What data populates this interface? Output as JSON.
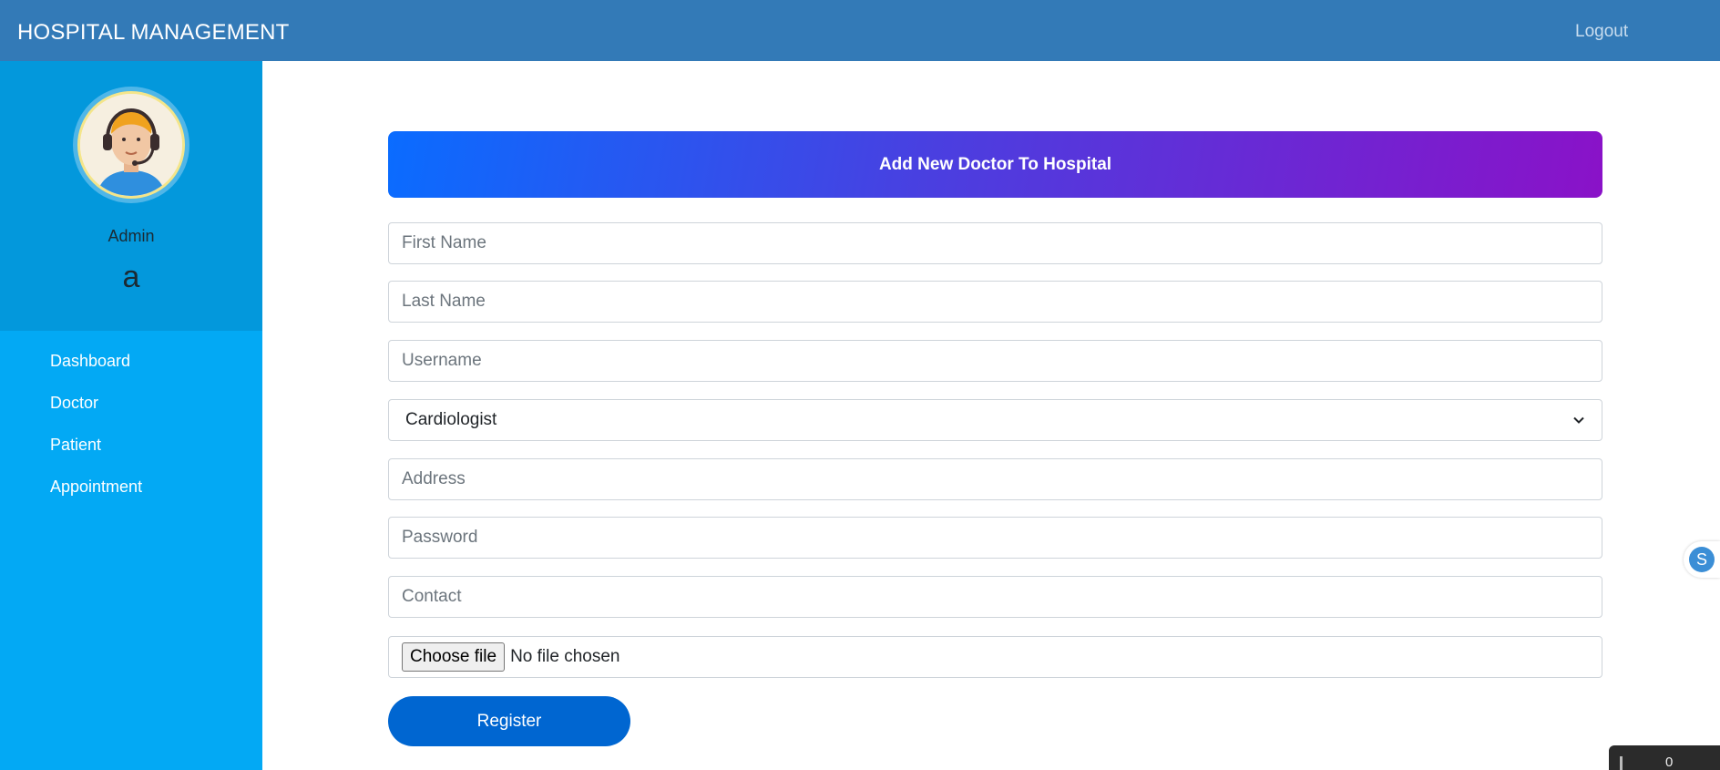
{
  "header": {
    "brand": "HOSPITAL MANAGEMENT",
    "logout_label": "Logout"
  },
  "sidebar": {
    "role": "Admin",
    "username": "a",
    "items": [
      {
        "label": "Dashboard"
      },
      {
        "label": "Doctor"
      },
      {
        "label": "Patient"
      },
      {
        "label": "Appointment"
      }
    ]
  },
  "form": {
    "title": "Add New Doctor To Hospital",
    "first_name_placeholder": "First Name",
    "last_name_placeholder": "Last Name",
    "username_placeholder": "Username",
    "department_value": "Cardiologist",
    "address_placeholder": "Address",
    "password_placeholder": "Password",
    "contact_placeholder": "Contact",
    "file_button_label": "Choose file",
    "file_status": "No file chosen",
    "submit_label": "Register"
  },
  "widgets": {
    "skype_letter": "S",
    "corner_text": "0"
  },
  "colors": {
    "header": "#337ab7",
    "sidebar": "#03a9f4",
    "profile": "#0398dc",
    "button": "#0066d1"
  }
}
